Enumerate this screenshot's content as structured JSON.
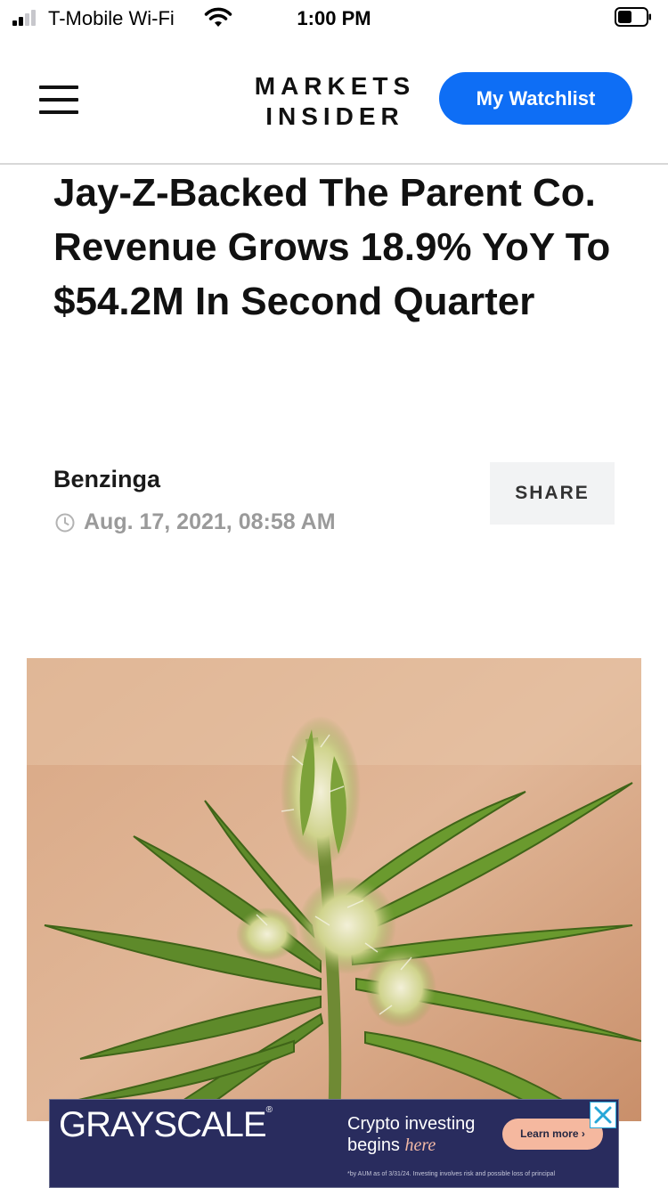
{
  "status_bar": {
    "carrier": "T-Mobile Wi-Fi",
    "time": "1:00 PM",
    "signal_icon": "signal-bars-icon",
    "wifi_icon": "wifi-icon",
    "battery_icon": "battery-icon"
  },
  "header": {
    "menu_icon": "hamburger-menu-icon",
    "logo_line1": "MARKETS",
    "logo_line2": "INSIDER",
    "watchlist_label": "My Watchlist",
    "accent_color": "#0e6ef5"
  },
  "article": {
    "headline": "Jay-Z-Backed The Parent Co. Revenue Grows 18.9% YoY To $54.2M In Second Quarter",
    "source": "Benzinga",
    "date": "Aug. 17, 2021, 08:58 AM",
    "date_icon": "clock-icon",
    "share_label": "SHARE",
    "hero_image": "cannabis-plant-photo"
  },
  "ad": {
    "brand": "GRAYSCALE",
    "line1": "Crypto investing",
    "line2_prefix": "begins ",
    "line2_emphasis": "here",
    "cta": "Learn more ›",
    "fine_print": "*by AUM as of 3/31/24. Investing involves risk and possible loss of principal",
    "close_icon": "close-icon",
    "background_color": "#292c5e"
  }
}
